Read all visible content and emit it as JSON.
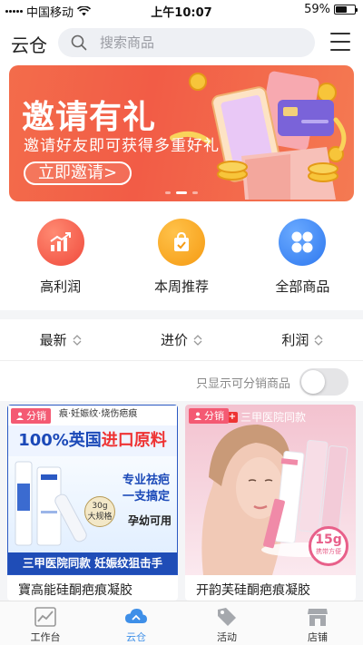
{
  "status_bar": {
    "carrier": "中国移动",
    "time": "上午10:07",
    "battery": "59%"
  },
  "header": {
    "title": "云仓",
    "search_placeholder": "搜索商品"
  },
  "banner": {
    "title": "邀请有礼",
    "subtitle": "邀请好友即可获得多重好礼",
    "button": "立即邀请>"
  },
  "quick_nav": [
    {
      "label": "高利润",
      "color": "#f2584a",
      "icon": "chart-up-icon"
    },
    {
      "label": "本周推荐",
      "color": "#f7a51f",
      "icon": "bag-icon"
    },
    {
      "label": "全部商品",
      "color": "#3a86f0",
      "icon": "grid-icon"
    }
  ],
  "sort_bar": {
    "items": [
      "最新",
      "进价",
      "利润"
    ]
  },
  "filter": {
    "label": "只显示可分销商品",
    "enabled": false
  },
  "products": [
    {
      "tag": "分销",
      "title": "寶高能硅酮疤痕凝胶",
      "image_text": {
        "top": "痕·妊娠纹·烧伤疤痕",
        "headline_a": "100%英国",
        "headline_b": "进口原料",
        "claim_1": "专业祛疤",
        "claim_2": "一支搞定",
        "claim_3": "孕幼可用",
        "size": "30g",
        "size_note": "大规格",
        "footer": "三甲医院同款 妊娠纹狙击手"
      }
    },
    {
      "tag": "分销",
      "title": "开韵芙硅酮疤痕凝胶",
      "image_text": {
        "top": "三甲医院同款",
        "size": "15g",
        "size_note": "携带方便"
      }
    }
  ],
  "tab_bar": [
    {
      "label": "工作台",
      "icon": "chart-icon",
      "active": false
    },
    {
      "label": "云仓",
      "icon": "cloud-icon",
      "active": true
    },
    {
      "label": "活动",
      "icon": "tag-icon",
      "active": false
    },
    {
      "label": "店铺",
      "icon": "store-icon",
      "active": false
    }
  ]
}
